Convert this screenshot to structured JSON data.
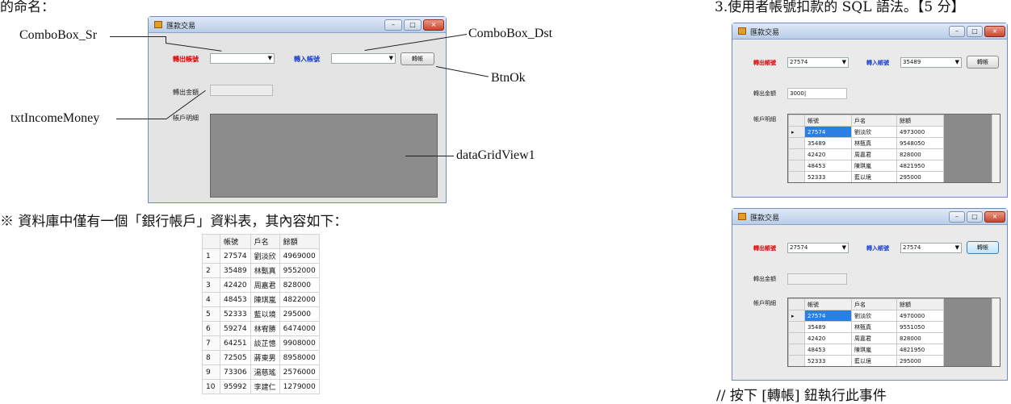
{
  "doc": {
    "top_left_fragment": "的命名：",
    "right_heading": "3.使用者帳號扣款的 SQL 語法。【5 分】",
    "db_intro": "※ 資料庫中僅有一個「銀行帳戶」資料表，其內容如下：",
    "footer_comment": "// 按下 [轉帳] 鈕執行此事件"
  },
  "annotations": {
    "combo_src": "ComboBox_Sr",
    "combo_dst": "ComboBox_Dst",
    "btn_ok": "BtnOk",
    "txt_income": "txtIncomeMoney",
    "datagrid": "dataGridView1"
  },
  "form": {
    "title": "匯款交易",
    "out_label": "轉出帳號",
    "in_label": "轉入帳號",
    "transfer_button": "轉帳",
    "amount_label": "轉出金額",
    "detail_label": "帳戶明細",
    "min_symbol": "–",
    "max_symbol": "□",
    "close_symbol": "×"
  },
  "db_table": {
    "headers": [
      "帳號",
      "戶名",
      "餘額"
    ],
    "rows": [
      [
        "1",
        "27574",
        "劉淡欣",
        "4969000"
      ],
      [
        "2",
        "35489",
        "林甄真",
        "9552000"
      ],
      [
        "3",
        "42420",
        "周嘉君",
        "828000"
      ],
      [
        "4",
        "48453",
        "陳琪嵐",
        "4822000"
      ],
      [
        "5",
        "52333",
        "藍以境",
        "295000"
      ],
      [
        "6",
        "59274",
        "林宥勝",
        "6474000"
      ],
      [
        "7",
        "64251",
        "談芷憶",
        "9908000"
      ],
      [
        "8",
        "72505",
        "蔣東男",
        "8958000"
      ],
      [
        "9",
        "73306",
        "湯慈瑤",
        "2576000"
      ],
      [
        "10",
        "95992",
        "李建仁",
        "1279000"
      ]
    ]
  },
  "screenshot1": {
    "out_value": "27574",
    "in_value": "35489",
    "amount_value": "3000|",
    "grid_rows": [
      [
        "27574",
        "劉淡欣",
        "4973000"
      ],
      [
        "35489",
        "林甄真",
        "9548050"
      ],
      [
        "42420",
        "周嘉君",
        "828000"
      ],
      [
        "48453",
        "陳琪嵐",
        "4821950"
      ],
      [
        "52333",
        "藍以境",
        "295000"
      ]
    ]
  },
  "screenshot2": {
    "out_value": "27574",
    "in_value": "27574",
    "amount_value": "",
    "grid_rows": [
      [
        "27574",
        "劉淡欣",
        "4970000"
      ],
      [
        "35489",
        "林甄真",
        "9551050"
      ],
      [
        "42420",
        "周嘉君",
        "828000"
      ],
      [
        "48453",
        "陳琪嵐",
        "4821950"
      ],
      [
        "52333",
        "藍以境",
        "295000"
      ]
    ]
  },
  "colors": {
    "accent_red": "#e00000",
    "accent_blue": "#1a3fd0",
    "selection": "#2b7fe0"
  }
}
